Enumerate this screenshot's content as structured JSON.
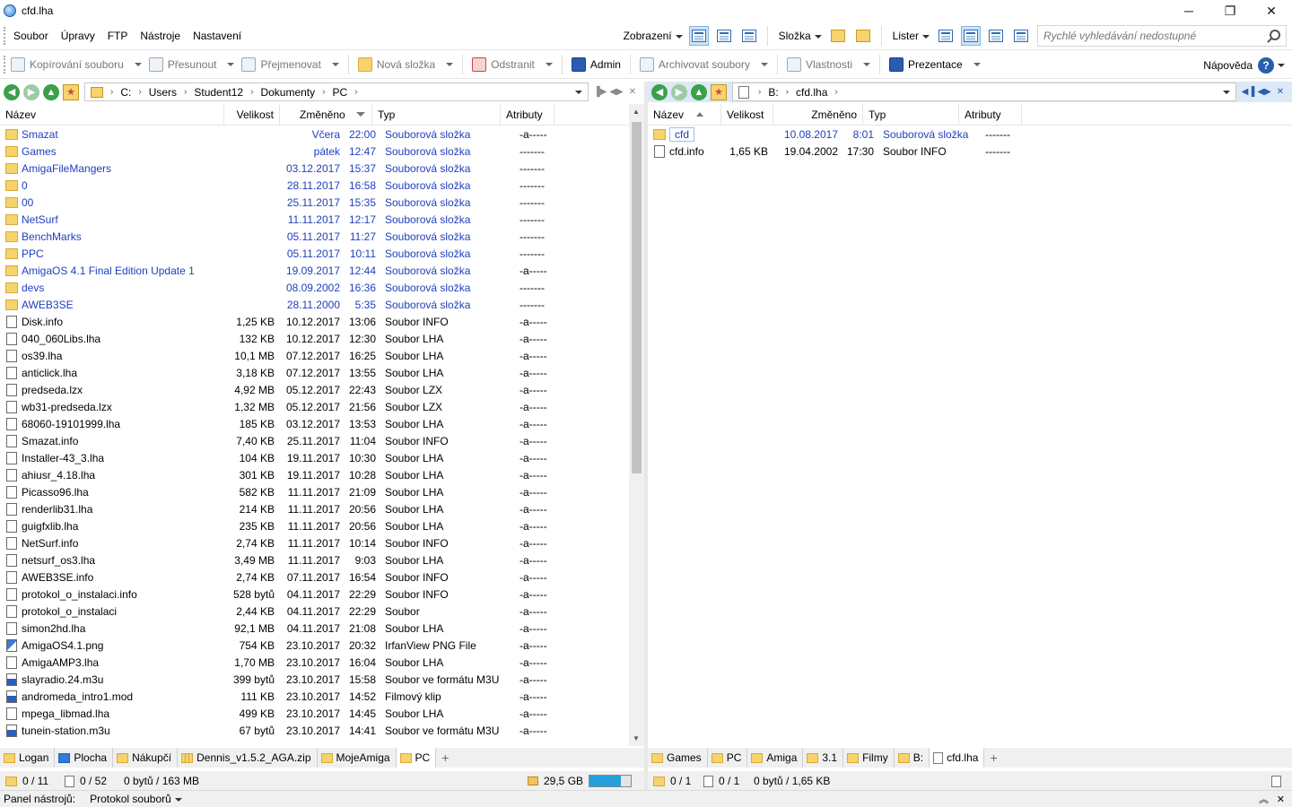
{
  "window": {
    "title": "cfd.lha",
    "controls": [
      "─",
      "❐",
      "✕"
    ]
  },
  "menu": [
    "Soubor",
    "Úpravy",
    "FTP",
    "Nástroje",
    "Nastavení"
  ],
  "view_menu": {
    "zobrazeni": "Zobrazení",
    "slozka": "Složka",
    "lister": "Lister"
  },
  "search": {
    "placeholder": "Rychlé vyhledávání nedostupné"
  },
  "toolbar": {
    "copy": "Kopírování souboru",
    "move": "Přesunout",
    "rename": "Přejmenovat",
    "new_folder": "Nová složka",
    "delete": "Odstranit",
    "admin": "Admin",
    "archive": "Archivovat soubory",
    "properties": "Vlastnosti",
    "presentation": "Prezentace",
    "help": "Nápověda"
  },
  "left": {
    "path": [
      "C:",
      "Users",
      "Student12",
      "Dokumenty",
      "PC"
    ],
    "columns": {
      "name": "Název",
      "size": "Velikost",
      "modified": "Změněno",
      "type": "Typ",
      "attr": "Atributy"
    },
    "rows": [
      {
        "name": "Smazat",
        "size": "",
        "date": "Včera",
        "time": "22:00",
        "type": "Souborová složka",
        "attr": "-a-----",
        "kind": "dir"
      },
      {
        "name": "Games",
        "size": "",
        "date": "pátek",
        "time": "12:47",
        "type": "Souborová složka",
        "attr": "-------",
        "kind": "dir"
      },
      {
        "name": "AmigaFileMangers",
        "size": "",
        "date": "03.12.2017",
        "time": "15:37",
        "type": "Souborová složka",
        "attr": "-------",
        "kind": "dir"
      },
      {
        "name": "0",
        "size": "",
        "date": "28.11.2017",
        "time": "16:58",
        "type": "Souborová složka",
        "attr": "-------",
        "kind": "dir"
      },
      {
        "name": "00",
        "size": "",
        "date": "25.11.2017",
        "time": "15:35",
        "type": "Souborová složka",
        "attr": "-------",
        "kind": "dir"
      },
      {
        "name": "NetSurf",
        "size": "",
        "date": "11.11.2017",
        "time": "12:17",
        "type": "Souborová složka",
        "attr": "-------",
        "kind": "dir"
      },
      {
        "name": "BenchMarks",
        "size": "",
        "date": "05.11.2017",
        "time": "11:27",
        "type": "Souborová složka",
        "attr": "-------",
        "kind": "dir"
      },
      {
        "name": "PPC",
        "size": "",
        "date": "05.11.2017",
        "time": "10:11",
        "type": "Souborová složka",
        "attr": "-------",
        "kind": "dir"
      },
      {
        "name": "AmigaOS 4.1 Final Edition Update 1",
        "size": "",
        "date": "19.09.2017",
        "time": "12:44",
        "type": "Souborová složka",
        "attr": "-a-----",
        "kind": "dir"
      },
      {
        "name": "devs",
        "size": "",
        "date": "08.09.2002",
        "time": "16:36",
        "type": "Souborová složka",
        "attr": "-------",
        "kind": "dir"
      },
      {
        "name": "AWEB3SE",
        "size": "",
        "date": "28.11.2000",
        "time": "5:35",
        "type": "Souborová složka",
        "attr": "-------",
        "kind": "dir"
      },
      {
        "name": "Disk.info",
        "size": "1,25 KB",
        "date": "10.12.2017",
        "time": "13:06",
        "type": "Soubor INFO",
        "attr": "-a-----",
        "kind": "file"
      },
      {
        "name": "040_060Libs.lha",
        "size": "132 KB",
        "date": "10.12.2017",
        "time": "12:30",
        "type": "Soubor LHA",
        "attr": "-a-----",
        "kind": "file"
      },
      {
        "name": "os39.lha",
        "size": "10,1 MB",
        "date": "07.12.2017",
        "time": "16:25",
        "type": "Soubor LHA",
        "attr": "-a-----",
        "kind": "file"
      },
      {
        "name": "anticlick.lha",
        "size": "3,18 KB",
        "date": "07.12.2017",
        "time": "13:55",
        "type": "Soubor LHA",
        "attr": "-a-----",
        "kind": "file"
      },
      {
        "name": "predseda.lzx",
        "size": "4,92 MB",
        "date": "05.12.2017",
        "time": "22:43",
        "type": "Soubor LZX",
        "attr": "-a-----",
        "kind": "file"
      },
      {
        "name": "wb31-predseda.lzx",
        "size": "1,32 MB",
        "date": "05.12.2017",
        "time": "21:56",
        "type": "Soubor LZX",
        "attr": "-a-----",
        "kind": "file"
      },
      {
        "name": "68060-19101999.lha",
        "size": "185 KB",
        "date": "03.12.2017",
        "time": "13:53",
        "type": "Soubor LHA",
        "attr": "-a-----",
        "kind": "file"
      },
      {
        "name": "Smazat.info",
        "size": "7,40 KB",
        "date": "25.11.2017",
        "time": "11:04",
        "type": "Soubor INFO",
        "attr": "-a-----",
        "kind": "file"
      },
      {
        "name": "Installer-43_3.lha",
        "size": "104 KB",
        "date": "19.11.2017",
        "time": "10:30",
        "type": "Soubor LHA",
        "attr": "-a-----",
        "kind": "file"
      },
      {
        "name": "ahiusr_4.18.lha",
        "size": "301 KB",
        "date": "19.11.2017",
        "time": "10:28",
        "type": "Soubor LHA",
        "attr": "-a-----",
        "kind": "file"
      },
      {
        "name": "Picasso96.lha",
        "size": "582 KB",
        "date": "11.11.2017",
        "time": "21:09",
        "type": "Soubor LHA",
        "attr": "-a-----",
        "kind": "file"
      },
      {
        "name": "renderlib31.lha",
        "size": "214 KB",
        "date": "11.11.2017",
        "time": "20:56",
        "type": "Soubor LHA",
        "attr": "-a-----",
        "kind": "file"
      },
      {
        "name": "guigfxlib.lha",
        "size": "235 KB",
        "date": "11.11.2017",
        "time": "20:56",
        "type": "Soubor LHA",
        "attr": "-a-----",
        "kind": "file"
      },
      {
        "name": "NetSurf.info",
        "size": "2,74 KB",
        "date": "11.11.2017",
        "time": "10:14",
        "type": "Soubor INFO",
        "attr": "-a-----",
        "kind": "file"
      },
      {
        "name": "netsurf_os3.lha",
        "size": "3,49 MB",
        "date": "11.11.2017",
        "time": "9:03",
        "type": "Soubor LHA",
        "attr": "-a-----",
        "kind": "file"
      },
      {
        "name": "AWEB3SE.info",
        "size": "2,74 KB",
        "date": "07.11.2017",
        "time": "16:54",
        "type": "Soubor INFO",
        "attr": "-a-----",
        "kind": "file"
      },
      {
        "name": "protokol_o_instalaci.info",
        "size": "528 bytů",
        "date": "04.11.2017",
        "time": "22:29",
        "type": "Soubor INFO",
        "attr": "-a-----",
        "kind": "file"
      },
      {
        "name": "protokol_o_instalaci",
        "size": "2,44 KB",
        "date": "04.11.2017",
        "time": "22:29",
        "type": "Soubor",
        "attr": "-a-----",
        "kind": "file"
      },
      {
        "name": "simon2hd.lha",
        "size": "92,1 MB",
        "date": "04.11.2017",
        "time": "21:08",
        "type": "Soubor LHA",
        "attr": "-a-----",
        "kind": "file"
      },
      {
        "name": "AmigaOS4.1.png",
        "size": "754 KB",
        "date": "23.10.2017",
        "time": "20:32",
        "type": "IrfanView PNG File",
        "attr": "-a-----",
        "kind": "img"
      },
      {
        "name": "AmigaAMP3.lha",
        "size": "1,70 MB",
        "date": "23.10.2017",
        "time": "16:04",
        "type": "Soubor LHA",
        "attr": "-a-----",
        "kind": "file"
      },
      {
        "name": "slayradio.24.m3u",
        "size": "399 bytů",
        "date": "23.10.2017",
        "time": "15:58",
        "type": "Soubor ve formátu M3U",
        "attr": "-a-----",
        "kind": "m3u"
      },
      {
        "name": "andromeda_intro1.mod",
        "size": "111 KB",
        "date": "23.10.2017",
        "time": "14:52",
        "type": "Filmový klip",
        "attr": "-a-----",
        "kind": "m3u"
      },
      {
        "name": "mpega_libmad.lha",
        "size": "499 KB",
        "date": "23.10.2017",
        "time": "14:45",
        "type": "Soubor LHA",
        "attr": "-a-----",
        "kind": "file"
      },
      {
        "name": "tunein-station.m3u",
        "size": "67 bytů",
        "date": "23.10.2017",
        "time": "14:41",
        "type": "Soubor ve formátu M3U",
        "attr": "-a-----",
        "kind": "m3u"
      }
    ],
    "tabs": [
      {
        "label": "Logan",
        "icon": "folder"
      },
      {
        "label": "Plocha",
        "icon": "blue"
      },
      {
        "label": "Nákupčí",
        "icon": "folder"
      },
      {
        "label": "Dennis_v1.5.2_AGA.zip",
        "icon": "zip"
      },
      {
        "label": "MojeAmiga",
        "icon": "folder"
      },
      {
        "label": "PC",
        "icon": "folder",
        "active": true
      }
    ],
    "status": {
      "folders": "0 / 11",
      "files": "0 / 52",
      "bytes": "0 bytů / 163 MB",
      "free": "29,5 GB",
      "used_fraction": 0.75
    }
  },
  "right": {
    "path": [
      "B:",
      "cfd.lha"
    ],
    "columns": {
      "name": "Název",
      "size": "Velikost",
      "modified": "Změněno",
      "type": "Typ",
      "attr": "Atributy"
    },
    "rows": [
      {
        "name": "cfd",
        "size": "",
        "date": "10.08.2017",
        "time": "8:01",
        "type": "Souborová složka",
        "attr": "-------",
        "kind": "dir"
      },
      {
        "name": "cfd.info",
        "size": "1,65 KB",
        "date": "19.04.2002",
        "time": "17:30",
        "type": "Soubor INFO",
        "attr": "-------",
        "kind": "file"
      }
    ],
    "tabs": [
      {
        "label": "Games",
        "icon": "folder"
      },
      {
        "label": "PC",
        "icon": "folder"
      },
      {
        "label": "Amiga",
        "icon": "folder"
      },
      {
        "label": "3.1",
        "icon": "folder"
      },
      {
        "label": "Filmy",
        "icon": "folder"
      },
      {
        "label": "B:",
        "icon": "folder"
      },
      {
        "label": "cfd.lha",
        "icon": "doc",
        "active": true
      }
    ],
    "status": {
      "folders": "0 / 1",
      "files": "0 / 1",
      "bytes": "0 bytů / 1,65 KB"
    }
  },
  "bottom": {
    "panel_label": "Panel nástrojů:",
    "panel_value": "Protokol souborů"
  }
}
